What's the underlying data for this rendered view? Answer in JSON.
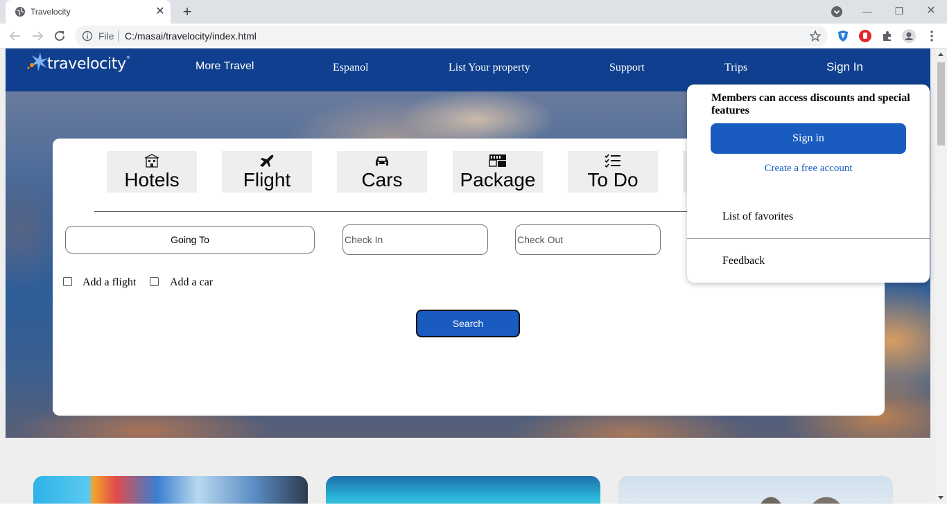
{
  "browser": {
    "tab_title": "Travelocity",
    "url_scheme": "File",
    "url": "C:/masai/travelocity/index.html"
  },
  "site": {
    "logo_text": "travelocity",
    "nav": {
      "more_travel": "More Travel",
      "espanol": "Espanol",
      "list_property": "List Your property",
      "support": "Support",
      "trips": "Trips",
      "sign_in": "Sign In"
    },
    "categories": [
      {
        "label": "Hotels",
        "icon": "hotel-icon"
      },
      {
        "label": "Flight",
        "icon": "plane-icon"
      },
      {
        "label": "Cars",
        "icon": "car-icon"
      },
      {
        "label": "Package",
        "icon": "package-icon"
      },
      {
        "label": "To Do",
        "icon": "checklist-icon"
      }
    ],
    "search": {
      "going_to": "Going To",
      "check_in": "Check In",
      "check_out": "Check Out",
      "add_flight": "Add a flight",
      "add_car": "Add a car",
      "search_button": "Search"
    },
    "dropdown": {
      "title": "Members can access discounts and special features",
      "sign_in": "Sign in",
      "create_account": "Create a free account",
      "favorites": "List of favorites",
      "feedback": "Feedback"
    },
    "colors": {
      "nav_bg": "#0f3f8e",
      "accent": "#1a5bbf"
    }
  }
}
